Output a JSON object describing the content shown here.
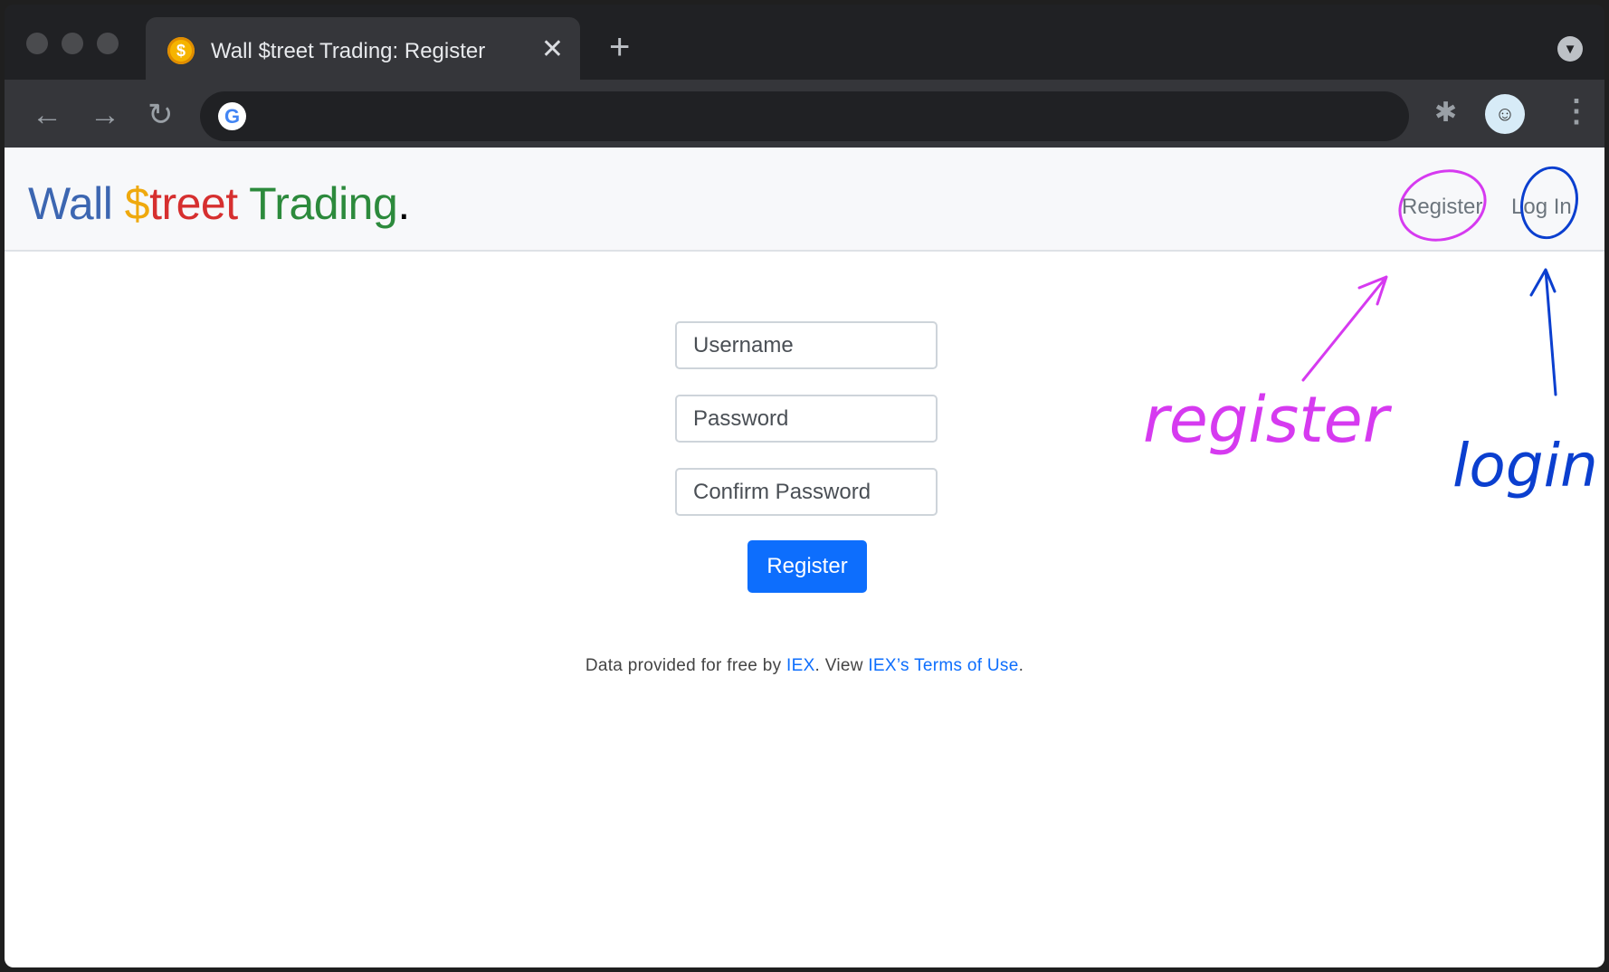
{
  "browser": {
    "tab_title": "Wall $treet Trading: Register",
    "tab_favicon_glyph": "$",
    "close_glyph": "✕",
    "new_tab_glyph": "+",
    "address": "",
    "icons": {
      "back": "back-arrow-icon",
      "forward": "forward-arrow-icon",
      "reload": "reload-icon",
      "google": "google-g-icon",
      "extensions": "puzzle-piece-icon",
      "profile": "profile-avatar-icon",
      "menu": "three-dot-menu-icon",
      "tab_search": "tab-search-icon"
    }
  },
  "navbar": {
    "brand": {
      "part1": "Wall ",
      "part2": "$",
      "part3": "treet ",
      "part4": "Trading",
      "part5": "."
    },
    "register_link": "Register",
    "login_link": "Log In"
  },
  "form": {
    "username_placeholder": "Username",
    "password_placeholder": "Password",
    "confirm_placeholder": "Confirm Password",
    "submit_label": "Register"
  },
  "footer": {
    "text1": "Data provided for free by ",
    "iex_link": "IEX",
    "text2": ". View ",
    "terms_link": "IEX’s Terms of Use",
    "text3": "."
  },
  "annotations": {
    "register_label": "register",
    "login_label": "login",
    "register_color": "#d63af0",
    "login_color": "#0b3fcf"
  },
  "colors": {
    "brand_wall": "#3c66b1",
    "brand_dollar": "#efa90e",
    "brand_treet": "#d62f2f",
    "brand_trading": "#2c8a3c",
    "primary_button": "#0d6efd"
  }
}
